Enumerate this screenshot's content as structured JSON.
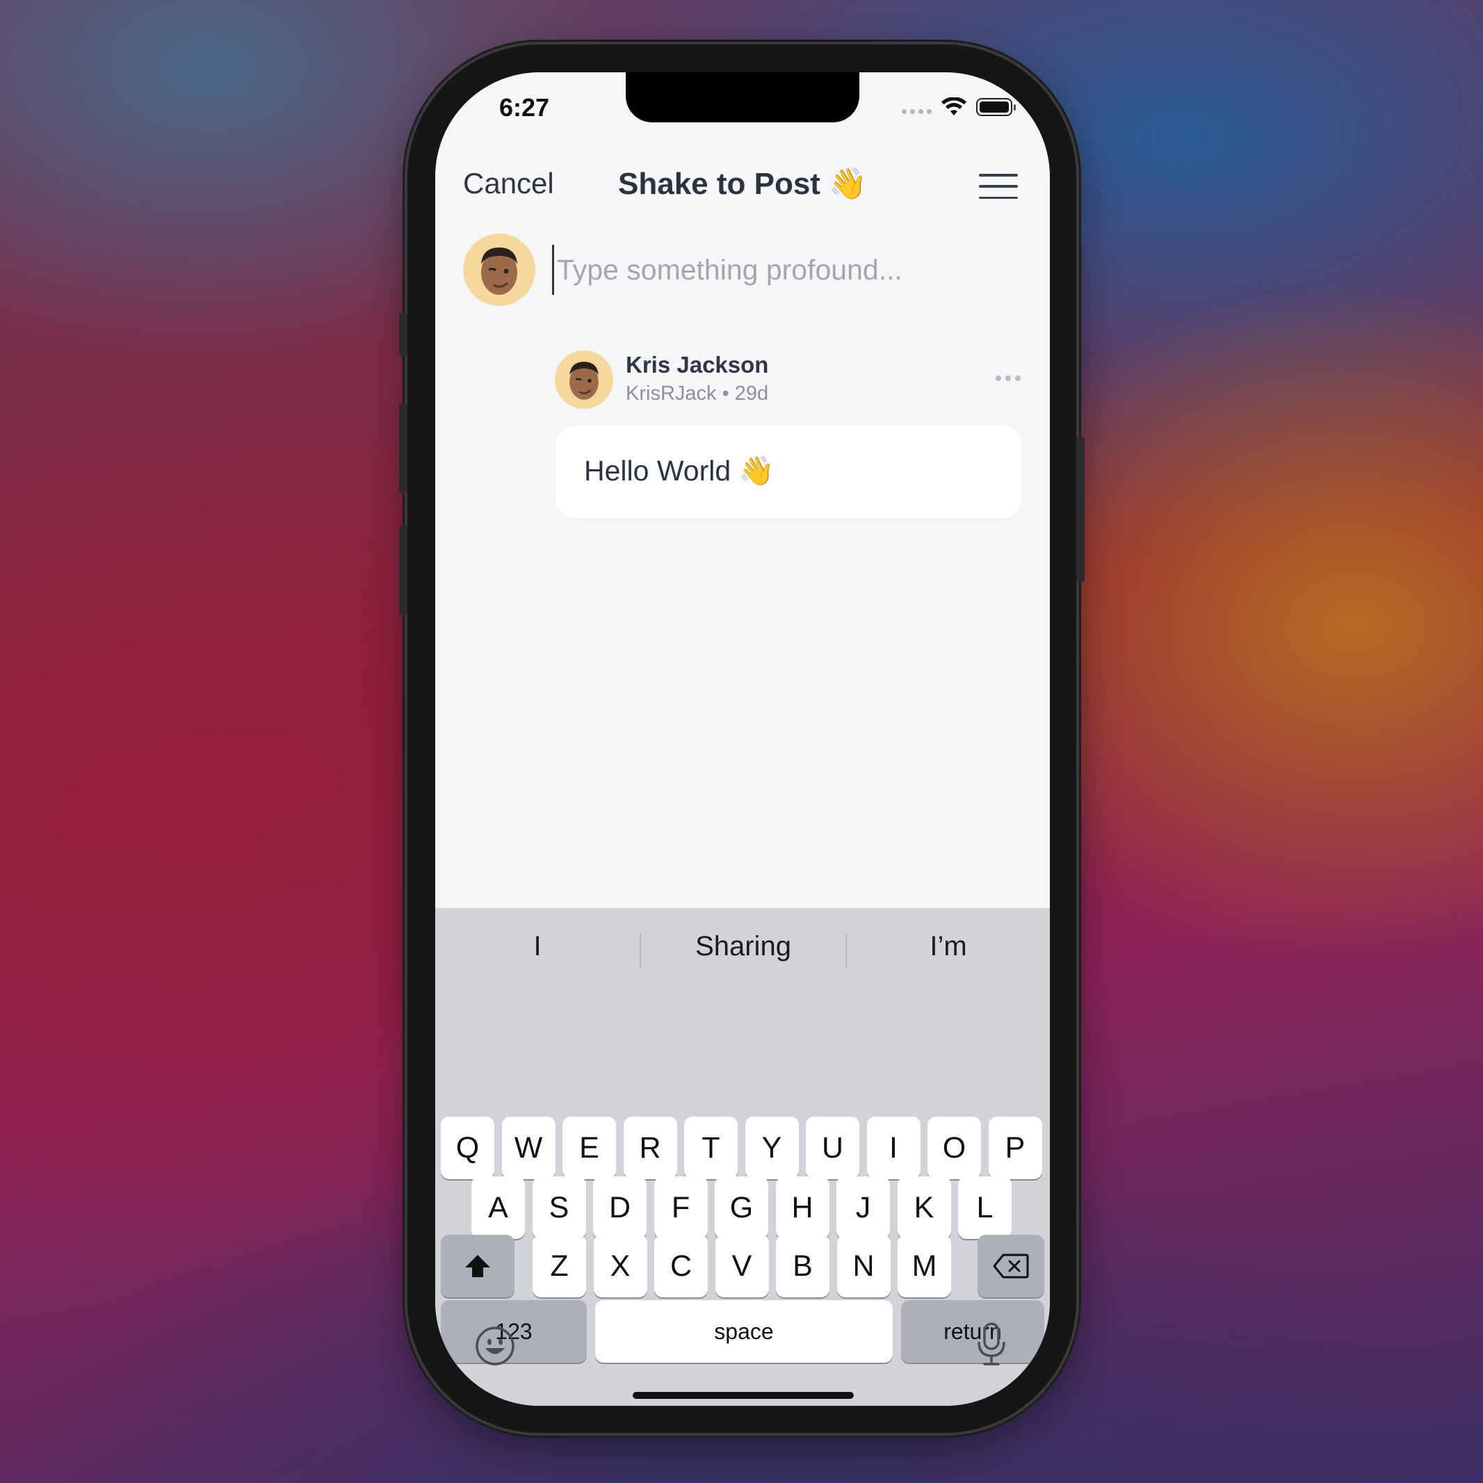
{
  "status_bar": {
    "time": "6:27"
  },
  "nav": {
    "cancel_label": "Cancel",
    "title": "Shake to Post 👋"
  },
  "compose": {
    "placeholder": "Type something profound...",
    "value": ""
  },
  "post": {
    "author_name": "Kris Jackson",
    "handle": "KrisRJack",
    "age": "29d",
    "meta": "KrisRJack • 29d",
    "text": "Hello World 👋"
  },
  "keyboard": {
    "suggestions": [
      "I",
      "Sharing",
      "I’m"
    ],
    "row1": [
      "Q",
      "W",
      "E",
      "R",
      "T",
      "Y",
      "U",
      "I",
      "O",
      "P"
    ],
    "row2": [
      "A",
      "S",
      "D",
      "F",
      "G",
      "H",
      "J",
      "K",
      "L"
    ],
    "row3": [
      "Z",
      "X",
      "C",
      "V",
      "B",
      "N",
      "M"
    ],
    "numbers_label": "123",
    "space_label": "space",
    "return_label": "return"
  },
  "icons": {
    "menu": "hamburger-menu-icon",
    "more": "more-dots-icon",
    "shift": "shift-icon",
    "delete": "backspace-icon",
    "emoji": "emoji-icon",
    "mic": "microphone-icon"
  },
  "colors": {
    "avatar_bg": "#f6d89c",
    "keyboard_bg": "#d1d3d9",
    "screen_bg": "#f6f6f8"
  }
}
